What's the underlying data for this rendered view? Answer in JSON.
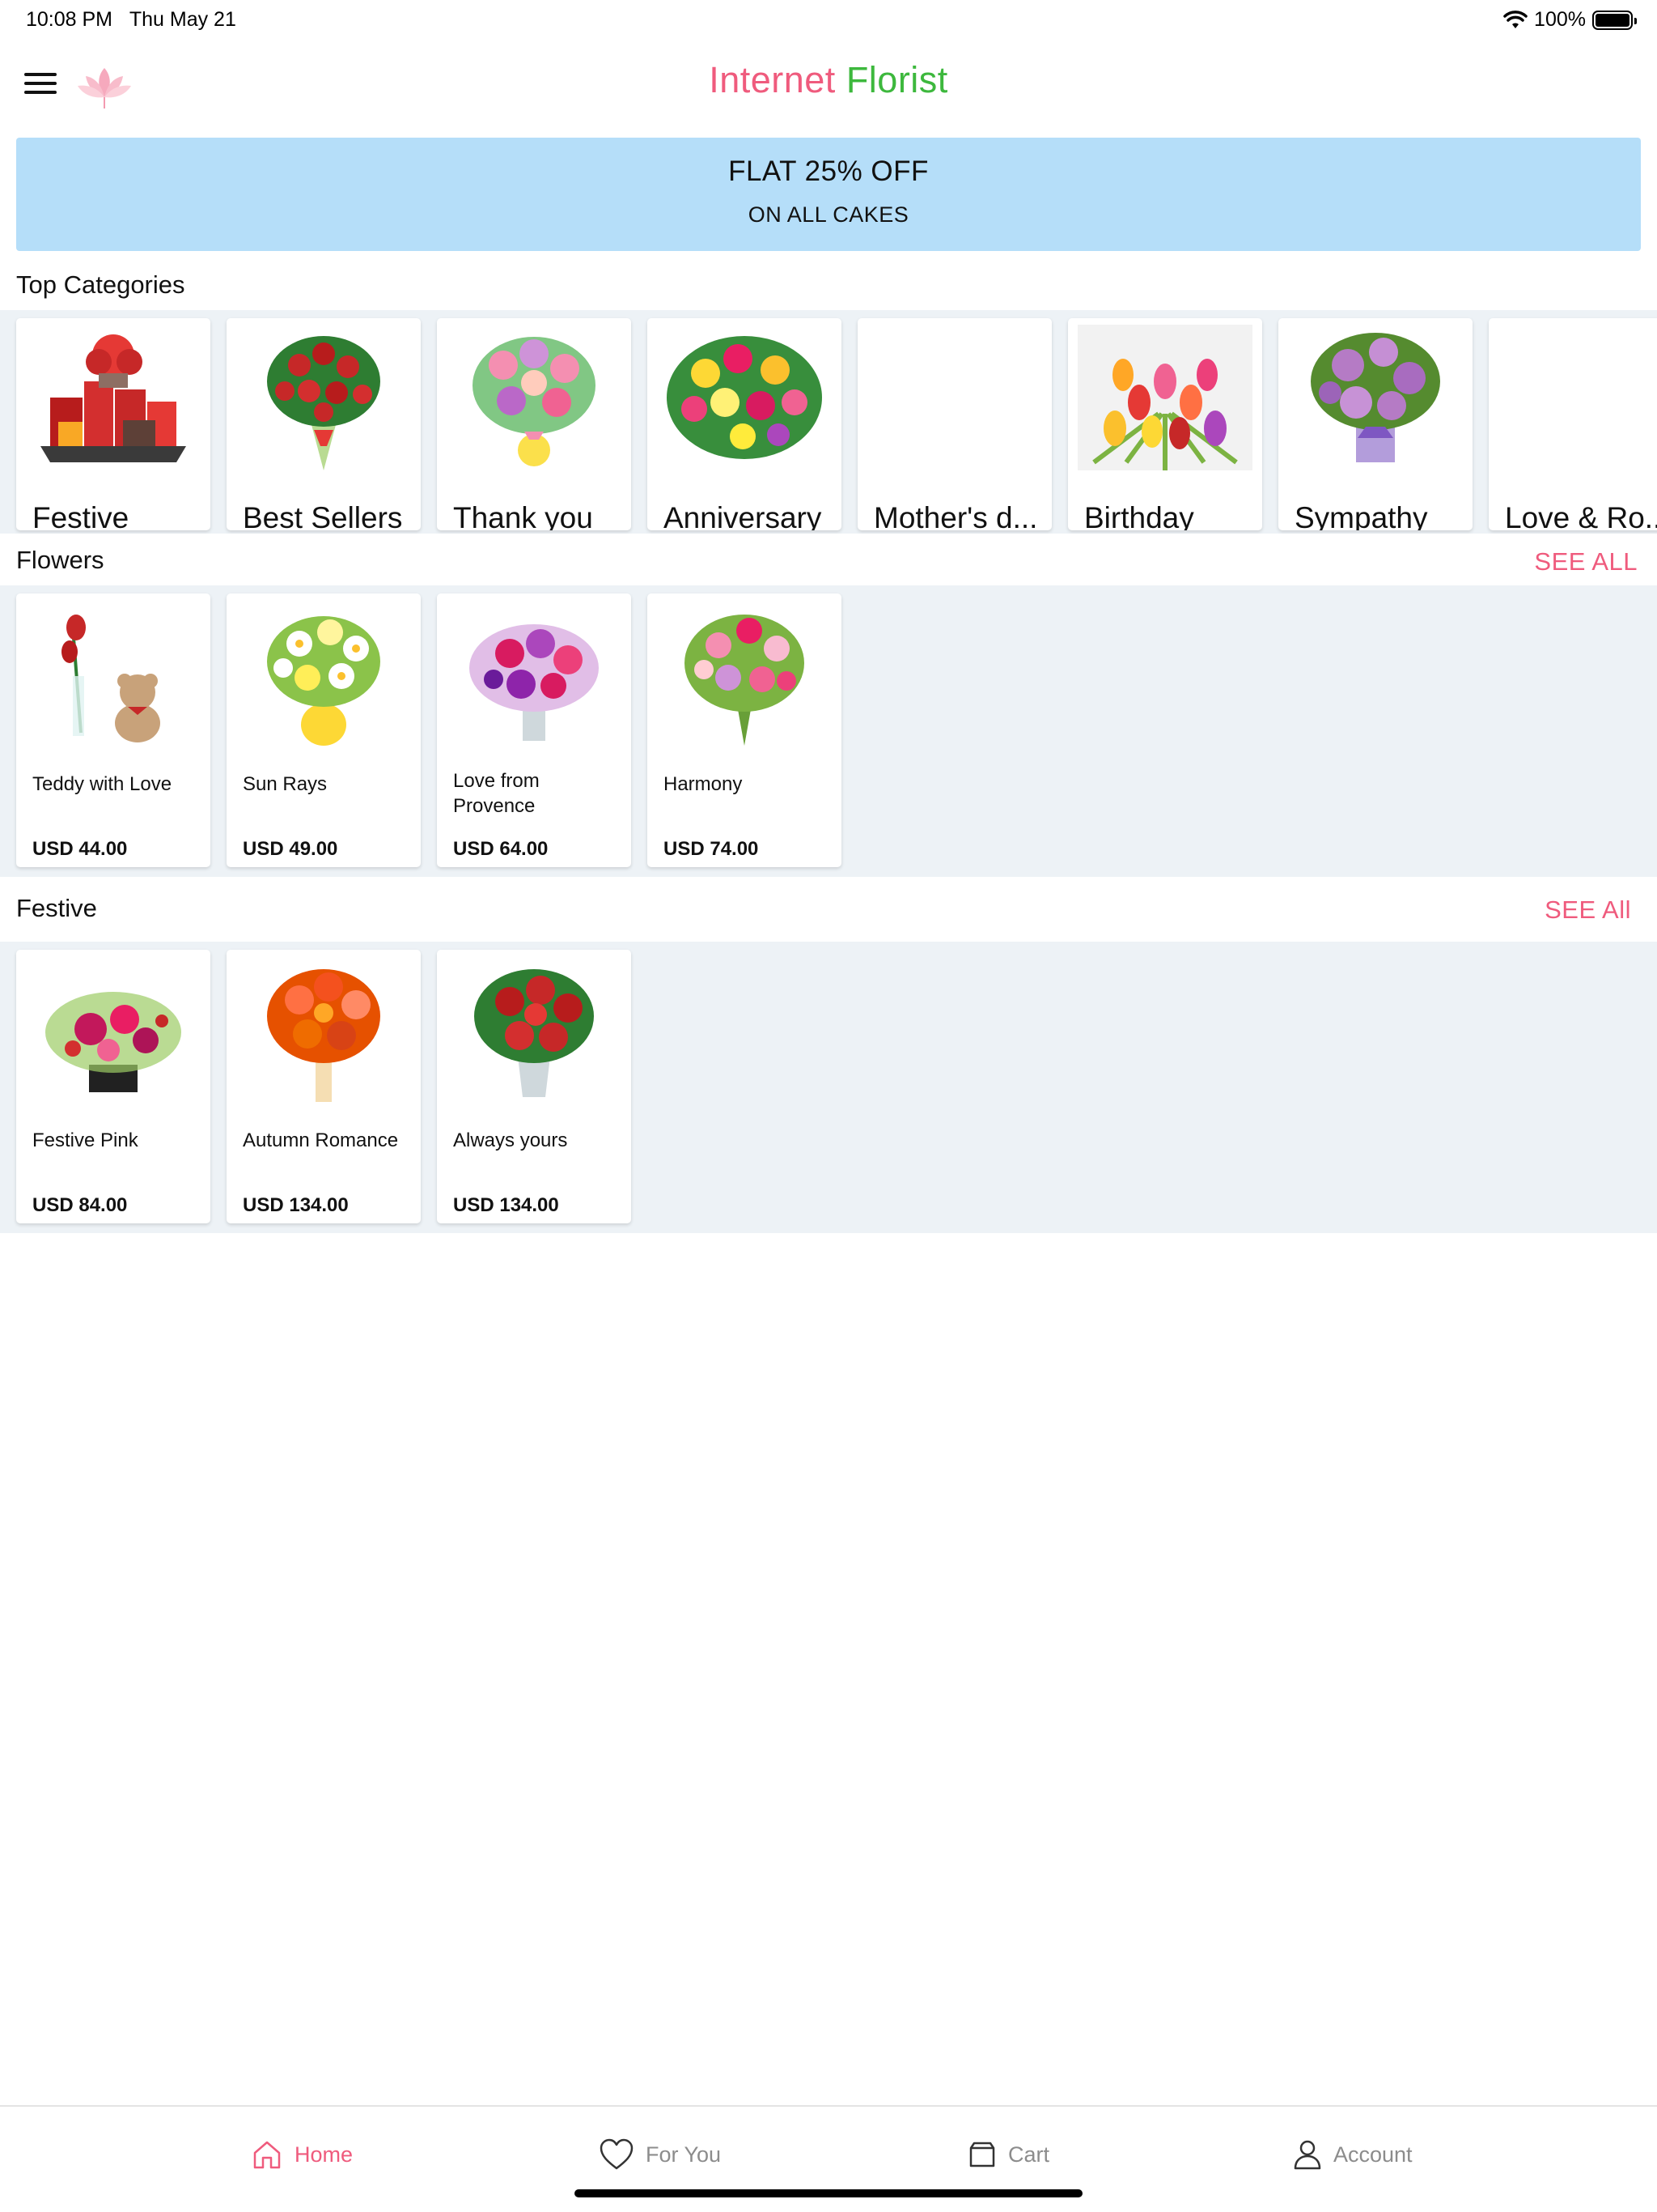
{
  "status_bar": {
    "time": "10:08 PM",
    "date": "Thu May 21",
    "battery_label": "100%",
    "battery_level": 1.0
  },
  "header": {
    "title_part1": "Internet",
    "title_part2": "Florist",
    "menu_icon": "hamburger-icon",
    "logo_icon": "lotus-icon"
  },
  "banner": {
    "title": "FLAT 25% OFF",
    "subtitle": "ON ALL CAKES"
  },
  "top_categories": {
    "title": "Top Categories",
    "items": [
      {
        "label": "Festive",
        "icon": "gift-basket-image"
      },
      {
        "label": "Best Sellers",
        "icon": "red-rose-bouquet-image"
      },
      {
        "label": "Thank you",
        "icon": "lily-vase-image"
      },
      {
        "label": "Anniversary",
        "icon": "mixed-bouquet-image"
      },
      {
        "label": "Mother's d...",
        "icon": ""
      },
      {
        "label": "Birthday",
        "icon": "tulips-image"
      },
      {
        "label": "Sympathy",
        "icon": "lavender-roses-image"
      },
      {
        "label": "Love & Ro...",
        "icon": ""
      }
    ]
  },
  "flowers": {
    "title": "Flowers",
    "see_all": "SEE ALL",
    "items": [
      {
        "name": "Teddy with Love",
        "price": "USD 44.00"
      },
      {
        "name": "Sun Rays",
        "price": "USD 49.00"
      },
      {
        "name": "Love from Provence",
        "price": "USD 64.00"
      },
      {
        "name": "Harmony",
        "price": "USD 74.00"
      }
    ]
  },
  "festive": {
    "title": "Festive",
    "see_all": "SEE All",
    "items": [
      {
        "name": "Festive Pink",
        "price": "USD 84.00"
      },
      {
        "name": "Autumn Romance",
        "price": "USD 134.00"
      },
      {
        "name": "Always yours",
        "price": "USD 134.00"
      }
    ]
  },
  "tabs": [
    {
      "label": "Home",
      "icon": "home-icon",
      "active": true
    },
    {
      "label": "For You",
      "icon": "heart-icon",
      "active": false
    },
    {
      "label": "Cart",
      "icon": "cart-icon",
      "active": false
    },
    {
      "label": "Account",
      "icon": "user-icon",
      "active": false
    }
  ],
  "colors": {
    "accent": "#ef5b7d",
    "brand_green": "#3db83d",
    "banner": "#b5def9",
    "strip_bg": "#edf2f6"
  }
}
